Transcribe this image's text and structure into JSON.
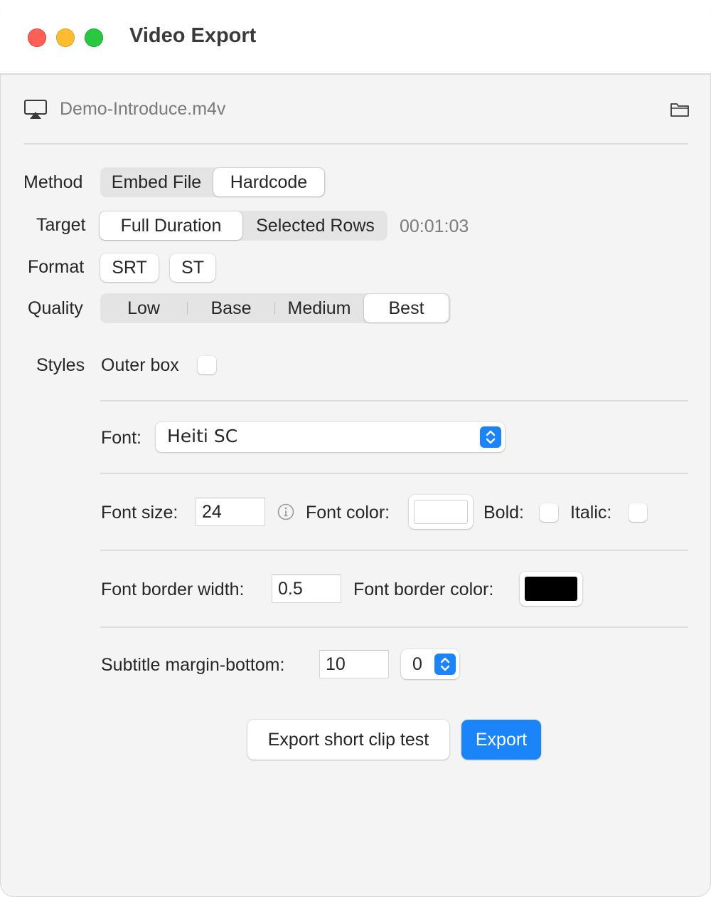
{
  "window": {
    "title": "Video Export"
  },
  "file": {
    "name": "Demo-Introduce.m4v",
    "airplay_icon": "airplay-icon",
    "folder_icon": "folder-icon"
  },
  "method": {
    "label": "Method",
    "options": [
      "Embed File",
      "Hardcode"
    ],
    "selected": "Hardcode"
  },
  "target": {
    "label": "Target",
    "options": [
      "Full Duration",
      "Selected Rows"
    ],
    "selected": "Full Duration",
    "duration": "00:01:03"
  },
  "format": {
    "label": "Format",
    "options": [
      "SRT",
      "ST"
    ]
  },
  "quality": {
    "label": "Quality",
    "options": [
      "Low",
      "Base",
      "Medium",
      "Best"
    ],
    "selected": "Best"
  },
  "styles": {
    "label": "Styles",
    "outer_box_label": "Outer box",
    "outer_box_checked": false,
    "font_label": "Font:",
    "font_value": "Heiti SC",
    "font_size_label": "Font size:",
    "font_size_value": "24",
    "font_color_label": "Font color:",
    "font_color": "#ffffff",
    "bold_label": "Bold:",
    "bold_checked": false,
    "italic_label": "Italic:",
    "italic_checked": false,
    "border_width_label": "Font border width:",
    "border_width_value": "0.5",
    "border_color_label": "Font border color:",
    "border_color": "#000000",
    "margin_bottom_label": "Subtitle margin-bottom:",
    "margin_bottom_value": "10",
    "margin_bottom_select": "0"
  },
  "actions": {
    "test_label": "Export short clip test",
    "export_label": "Export"
  },
  "colors": {
    "accent": "#1a84f8",
    "close": "#fe5f57",
    "minimize": "#febc2e",
    "zoom": "#28c840"
  }
}
